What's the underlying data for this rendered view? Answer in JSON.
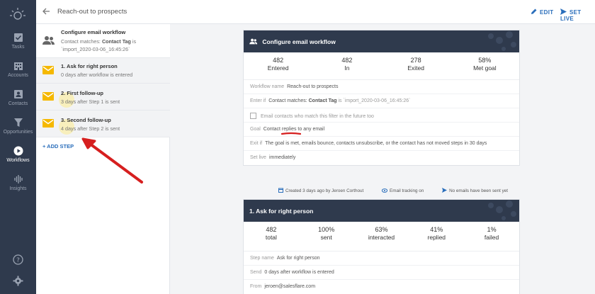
{
  "header": {
    "title": "Reach-out to prospects",
    "edit_label": "EDIT",
    "set_live_label": "SET LIVE"
  },
  "nav": {
    "items": [
      {
        "label": "Tasks"
      },
      {
        "label": "Accounts"
      },
      {
        "label": "Contacts"
      },
      {
        "label": "Opportunities"
      },
      {
        "label": "Workflows"
      },
      {
        "label": "Insights"
      }
    ]
  },
  "steps": {
    "config": {
      "title": "Configure email workflow",
      "line1_prefix": "Contact matches: ",
      "line1_bold": "Contact Tag",
      "line1_suffix": " is",
      "line2": "`import_2020-03-06_16:45:26`"
    },
    "items": [
      {
        "title": "1. Ask for right person",
        "sub": "0 days after workflow is entered"
      },
      {
        "title": "2. First follow-up",
        "sub": "3 days after Step 1 is sent"
      },
      {
        "title": "3. Second follow-up",
        "sub": "4 days after Step 2 is sent"
      }
    ],
    "add_label": "+ ADD STEP"
  },
  "config_card": {
    "title": "Configure email workflow",
    "stats": [
      {
        "value": "482",
        "label": "Entered"
      },
      {
        "value": "482",
        "label": "In"
      },
      {
        "value": "278",
        "label": "Exited"
      },
      {
        "value": "58%",
        "label": "Met goal"
      }
    ],
    "name_label": "Workflow name",
    "name_value": "Reach-out to prospects",
    "enter_label": "Enter if",
    "enter_prefix": "Contact matches: ",
    "enter_bold": "Contact Tag",
    "enter_suffix": " is `import_2020-03-06_16:45:26`",
    "future_label": "Email contacts who match this filter in the future too",
    "goal_label": "Goal",
    "goal_value": "Contact replies to any email",
    "exit_label": "Exit if",
    "exit_value": "The goal is met, emails bounce, contacts unsubscribe, or the contact has not moved steps in 30 days",
    "live_label": "Set live",
    "live_value": "immediately"
  },
  "meta": {
    "created": "Created 3 days ago by Jeroen Corthout",
    "tracking": "Email tracking on",
    "sent": "No emails have been sent yet"
  },
  "step_card": {
    "title": "1. Ask for right person",
    "stats": [
      {
        "value": "482",
        "label": "total"
      },
      {
        "value": "100%",
        "label": "sent"
      },
      {
        "value": "63%",
        "label": "interacted"
      },
      {
        "value": "41%",
        "label": "replied"
      },
      {
        "value": "1%",
        "label": "failed"
      }
    ],
    "name_label": "Step name",
    "name_value": "Ask for right person",
    "send_label": "Send",
    "send_value": "0 days after workflow is entered",
    "from_label": "From",
    "from_value": "jeroen@salesflare.com"
  },
  "colors": {
    "nav_bg": "#2f3a4d",
    "accent": "#2a6ebb",
    "email_icon": "#f5b800",
    "annotation": "#d61f1f"
  }
}
